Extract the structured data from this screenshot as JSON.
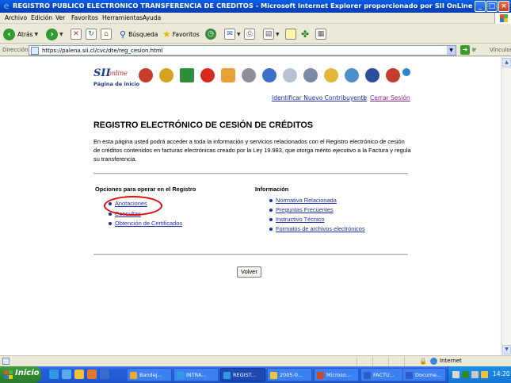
{
  "window": {
    "title": "REGISTRO PUBLICO ELECTRONICO TRANSFERENCIA DE CREDITOS - Microsoft Internet Explorer proporcionado por SII OnLine"
  },
  "menu": [
    "Archivo",
    "Edición",
    "Ver",
    "Favoritos",
    "Herramientas",
    "Ayuda"
  ],
  "toolbar": {
    "back_label": "Atrás",
    "search_label": "Búsqueda",
    "favorites_label": "Favoritos"
  },
  "address": {
    "label": "Dirección",
    "url": "https://palena.sii.cl/cvc/dte/reg_cesion.html",
    "go_label": "Ir",
    "links_label": "Vínculos"
  },
  "page": {
    "logo": {
      "brand": "SII",
      "brand_sub": "online",
      "home_caption": "Página de inicio"
    },
    "top_links": {
      "identify": "Identificar Nuevo Contribuyente",
      "separator": "|",
      "logout": "Cerrar Sesión"
    },
    "heading": "REGISTRO ELECTRÓNICO DE CESIÓN DE CRÉDITOS",
    "intro": "En esta página usted podrá acceder a toda la información y servicios relacionados con el Registro electrónico de cesión de créditos contenidos en facturas electrónicas creado por la Ley 19.983, que otorga mérito ejecutivo a la Factura y regula su transferencia.",
    "options": {
      "title": "Opciones para operar en el Registro",
      "items": [
        "Anotaciones",
        "Consultas",
        "Obtención de Certificados"
      ]
    },
    "info": {
      "title": "Información",
      "items": [
        "Normativa Relacionada",
        "Preguntas Frecuentes",
        "Instructivo Técnico",
        "Formatos de archivos electrónicos"
      ]
    },
    "back_button": "Volver"
  },
  "status": {
    "zone": "Internet"
  },
  "taskbar": {
    "start_label": "Inicio",
    "tasks": [
      "Bandej...",
      "INTRA...",
      "REGIST...",
      "2005-0...",
      "Microso...",
      "FACTU...",
      "Docume..."
    ],
    "clock": "14:20"
  },
  "colors": {
    "link": "#1f2fa8",
    "annotation_circle": "#e10a0a",
    "titlebar": "#0646c4"
  }
}
